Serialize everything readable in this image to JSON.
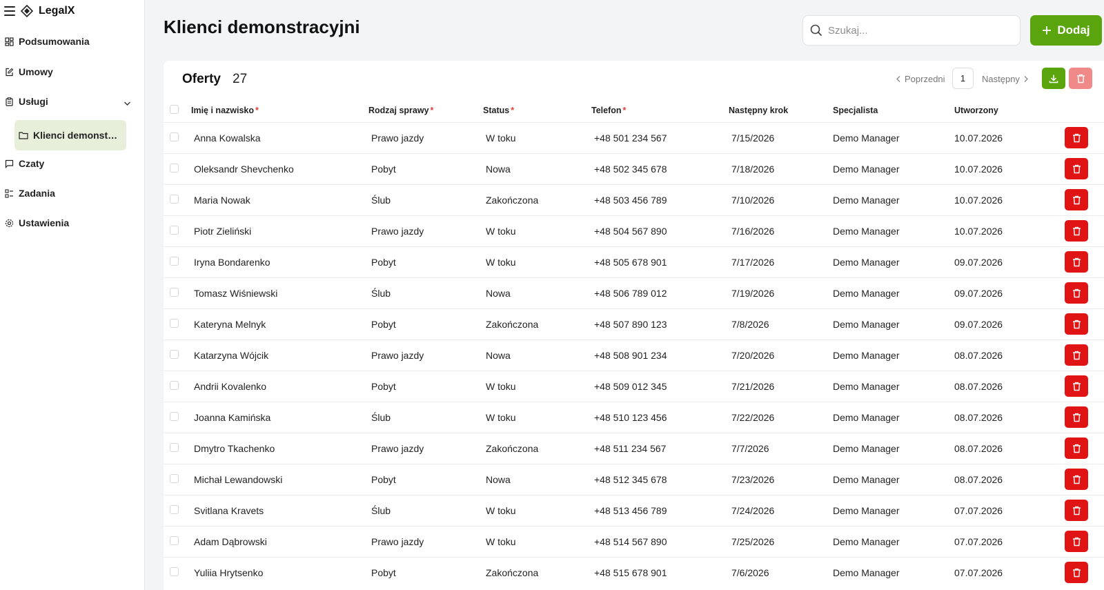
{
  "app": {
    "name": "LegalX"
  },
  "sidebar": {
    "items": [
      {
        "label": "Podsumowania",
        "icon": "dashboard-icon"
      },
      {
        "label": "Umowy",
        "icon": "edit-document-icon"
      },
      {
        "label": "Usługi",
        "icon": "clipboard-icon"
      },
      {
        "label": "Czaty",
        "icon": "chat-icon"
      },
      {
        "label": "Zadania",
        "icon": "task-list-icon"
      },
      {
        "label": "Ustawienia",
        "icon": "gear-icon"
      }
    ],
    "sub_item": {
      "label": "Klienci demonstracyjni",
      "icon": "folder-icon"
    }
  },
  "header": {
    "title": "Klienci demonstracyjni",
    "search_placeholder": "Szukaj...",
    "add_label": "Dodaj"
  },
  "card": {
    "title": "Oferty",
    "count": "27",
    "prev_label": "Poprzedni",
    "next_label": "Następny",
    "page": "1"
  },
  "table": {
    "columns": [
      {
        "label": "Imię i nazwisko",
        "required": "*"
      },
      {
        "label": "Rodzaj sprawy",
        "required": "*"
      },
      {
        "label": "Status",
        "required": "*"
      },
      {
        "label": "Telefon",
        "required": "*"
      },
      {
        "label": "Następny krok",
        "required": ""
      },
      {
        "label": "Specjalista",
        "required": ""
      },
      {
        "label": "Utworzony",
        "required": ""
      }
    ],
    "rows": [
      [
        "Anna Kowalska",
        "Prawo jazdy",
        "W toku",
        "+48 501 234 567",
        "7/15/2026",
        "Demo Manager",
        "10.07.2026"
      ],
      [
        "Oleksandr Shevchenko",
        "Pobyt",
        "Nowa",
        "+48 502 345 678",
        "7/18/2026",
        "Demo Manager",
        "10.07.2026"
      ],
      [
        "Maria Nowak",
        "Ślub",
        "Zakończona",
        "+48 503 456 789",
        "7/10/2026",
        "Demo Manager",
        "10.07.2026"
      ],
      [
        "Piotr Zieliński",
        "Prawo jazdy",
        "W toku",
        "+48 504 567 890",
        "7/16/2026",
        "Demo Manager",
        "10.07.2026"
      ],
      [
        "Iryna Bondarenko",
        "Pobyt",
        "W toku",
        "+48 505 678 901",
        "7/17/2026",
        "Demo Manager",
        "09.07.2026"
      ],
      [
        "Tomasz Wiśniewski",
        "Ślub",
        "Nowa",
        "+48 506 789 012",
        "7/19/2026",
        "Demo Manager",
        "09.07.2026"
      ],
      [
        "Kateryna Melnyk",
        "Pobyt",
        "Zakończona",
        "+48 507 890 123",
        "7/8/2026",
        "Demo Manager",
        "09.07.2026"
      ],
      [
        "Katarzyna Wójcik",
        "Prawo jazdy",
        "Nowa",
        "+48 508 901 234",
        "7/20/2026",
        "Demo Manager",
        "08.07.2026"
      ],
      [
        "Andrii Kovalenko",
        "Pobyt",
        "W toku",
        "+48 509 012 345",
        "7/21/2026",
        "Demo Manager",
        "08.07.2026"
      ],
      [
        "Joanna Kamińska",
        "Ślub",
        "W toku",
        "+48 510 123 456",
        "7/22/2026",
        "Demo Manager",
        "08.07.2026"
      ],
      [
        "Dmytro Tkachenko",
        "Prawo jazdy",
        "Zakończona",
        "+48 511 234 567",
        "7/7/2026",
        "Demo Manager",
        "08.07.2026"
      ],
      [
        "Michał Lewandowski",
        "Pobyt",
        "Nowa",
        "+48 512 345 678",
        "7/23/2026",
        "Demo Manager",
        "08.07.2026"
      ],
      [
        "Svitlana Kravets",
        "Ślub",
        "W toku",
        "+48 513 456 789",
        "7/24/2026",
        "Demo Manager",
        "07.07.2026"
      ],
      [
        "Adam Dąbrowski",
        "Prawo jazdy",
        "W toku",
        "+48 514 567 890",
        "7/25/2026",
        "Demo Manager",
        "07.07.2026"
      ],
      [
        "Yuliia Hrytsenko",
        "Pobyt",
        "Zakończona",
        "+48 515 678 901",
        "7/6/2026",
        "Demo Manager",
        "07.07.2026"
      ]
    ]
  },
  "colors": {
    "accent": "#5aa40e",
    "danger": "#e01414",
    "danger_light": "#f08a88",
    "active_nav": "#e7efdb",
    "required": "#e23c3c"
  }
}
